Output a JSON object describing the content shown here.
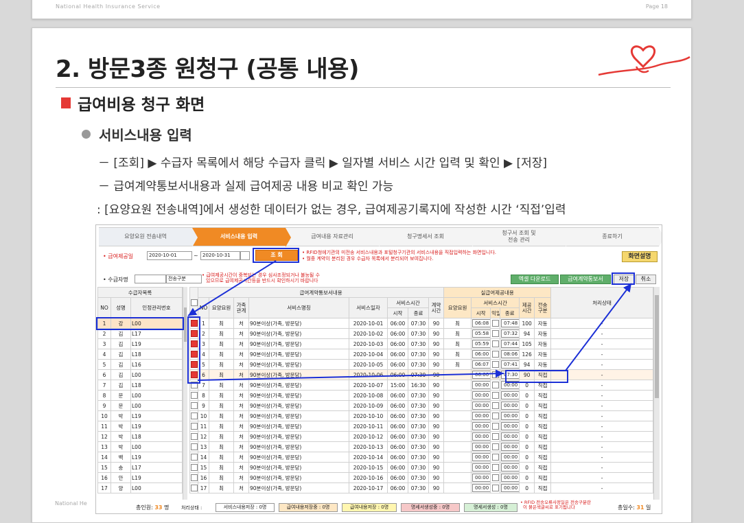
{
  "prev_slide": {
    "footer": "National Health Insurance Service",
    "page": "Page 18"
  },
  "slide": {
    "title": "2. 방문3종 원청구 (공통 내용)",
    "section": "급여비용 청구 화면",
    "subsection": "서비스내용 입력",
    "bullets": [
      "－ [조회] ▶ 수급자 목록에서 해당 수급자 클릭 ▶ 일자별 서비스 시간 입력 및 확인 ▶ [저장]",
      "－ 급여계약통보서내용과 실제 급여제공 내용 비교 확인 가능",
      ": [요양요원 전송내역]에서 생성한 데이터가 없는 경우, 급여제공기록지에 작성한 시간 ‘직접’입력"
    ],
    "footer_partial": "National He"
  },
  "colors": {
    "accent": "#f08a24",
    "highlight_box": "#1b2fd6",
    "bullet_square": "#e53935",
    "logo": "#e53935"
  },
  "app": {
    "steps": [
      "요양요원 전송내역",
      "서비스내용 입력",
      "급여내용 자료관리",
      "청구명세서 조회",
      "청구서 조회 및\n전송 관리",
      "종료하기"
    ],
    "active_step": 1,
    "filter": {
      "period_label": "• 급여제공일",
      "date_from": "2020-10-01",
      "date_to": "2020-10-31",
      "tilde": "~",
      "search_button": "조 회",
      "notice_1": "• RFID청에기관의 미전송 서비스내용과 포털청구기관의 서비스내용을 직접입력하는 화면입니다.",
      "notice_2": "• 월중 계약이 분리된 경우 수급자 목록에서 분리되어 보여집니다.",
      "screen_help": "화면설명",
      "recipient_label": "• 수급자명",
      "send_type": "전송구분",
      "warn_1": "• 급여제공시간이 중복되는 경우 심사조정되거나 불능될 수",
      "warn_2": "있으므로 급여제공시간등을 반드시 확인하시기 바랍니다",
      "excel_button": "엑셀 다운로드",
      "contract_button": "급여계약통보서",
      "save_button": "저장",
      "cancel_button": "취소"
    },
    "left_table": {
      "group": "수급자목록",
      "headers": [
        "NO",
        "성명",
        "인정관리번호"
      ],
      "rows": [
        [
          "1",
          "강",
          "L00"
        ],
        [
          "2",
          "김",
          "L17"
        ],
        [
          "3",
          "김",
          "L19"
        ],
        [
          "4",
          "김",
          "L18"
        ],
        [
          "5",
          "김",
          "L16"
        ],
        [
          "6",
          "김",
          "L00"
        ],
        [
          "7",
          "김",
          "L18"
        ],
        [
          "8",
          "문",
          "L00"
        ],
        [
          "9",
          "문",
          "L00"
        ],
        [
          "10",
          "박",
          "L19"
        ],
        [
          "11",
          "박",
          "L19"
        ],
        [
          "12",
          "박",
          "L18"
        ],
        [
          "13",
          "박",
          "L00"
        ],
        [
          "14",
          "백",
          "L19"
        ],
        [
          "15",
          "송",
          "L17"
        ],
        [
          "16",
          "안",
          "L19"
        ],
        [
          "17",
          "양",
          "L00"
        ]
      ]
    },
    "right_table": {
      "contract_group": "급여계약통보서내용",
      "actual_group": "실급여제공내용",
      "headers": [
        "NO",
        "요양요원",
        "가족\n관계",
        "서비스명칭",
        "서비스일자",
        "서비스시간",
        "계약\n시간",
        "요양요원",
        "서비스시간",
        "제공\n시간",
        "전송\n구분",
        "처리상태"
      ],
      "sub_start": "시작",
      "sub_end": "종료",
      "sub_next": "익일",
      "rows": [
        {
          "no": "1",
          "worker": "최",
          "rel": "처",
          "svc": "90분이상(가족, 방문당)",
          "date": "2020-10-01",
          "start": "06:00",
          "end": "07:30",
          "ct": "90",
          "aw": "최",
          "as": "06:08",
          "ae": "07:48",
          "pt": "100",
          "tx": "자동",
          "st": "-"
        },
        {
          "no": "2",
          "worker": "최",
          "rel": "처",
          "svc": "90분이상(가족, 방문당)",
          "date": "2020-10-02",
          "start": "06:00",
          "end": "07:30",
          "ct": "90",
          "aw": "최",
          "as": "05:58",
          "ae": "07:32",
          "pt": "94",
          "tx": "자동",
          "st": "-"
        },
        {
          "no": "3",
          "worker": "최",
          "rel": "처",
          "svc": "90분이상(가족, 방문당)",
          "date": "2020-10-03",
          "start": "06:00",
          "end": "07:30",
          "ct": "90",
          "aw": "최",
          "as": "05:59",
          "ae": "07:44",
          "pt": "105",
          "tx": "자동",
          "st": "-"
        },
        {
          "no": "4",
          "worker": "최",
          "rel": "처",
          "svc": "90분이상(가족, 방문당)",
          "date": "2020-10-04",
          "start": "06:00",
          "end": "07:30",
          "ct": "90",
          "aw": "최",
          "as": "06:00",
          "ae": "08:06",
          "pt": "126",
          "tx": "자동",
          "st": "-"
        },
        {
          "no": "5",
          "worker": "최",
          "rel": "처",
          "svc": "90분이상(가족, 방문당)",
          "date": "2020-10-05",
          "start": "06:00",
          "end": "07:30",
          "ct": "90",
          "aw": "최",
          "as": "06:07",
          "ae": "07:41",
          "pt": "94",
          "tx": "자동",
          "st": "-"
        },
        {
          "no": "6",
          "worker": "최",
          "rel": "처",
          "svc": "90분이상(가족, 방문당)",
          "date": "2020-10-06",
          "start": "06:00",
          "end": "07:30",
          "ct": "90",
          "aw": "",
          "as": "06:00",
          "ae": "07:30",
          "pt": "90",
          "tx": "직접",
          "st": "-"
        },
        {
          "no": "7",
          "worker": "최",
          "rel": "처",
          "svc": "90분이상(가족, 방문당)",
          "date": "2020-10-07",
          "start": "15:00",
          "end": "16:30",
          "ct": "90",
          "aw": "",
          "as": "00:00",
          "ae": "00:00",
          "pt": "0",
          "tx": "직접",
          "st": "-"
        },
        {
          "no": "8",
          "worker": "최",
          "rel": "처",
          "svc": "90분이상(가족, 방문당)",
          "date": "2020-10-08",
          "start": "06:00",
          "end": "07:30",
          "ct": "90",
          "aw": "",
          "as": "00:00",
          "ae": "00:00",
          "pt": "0",
          "tx": "직접",
          "st": "-"
        },
        {
          "no": "9",
          "worker": "최",
          "rel": "처",
          "svc": "90분이상(가족, 방문당)",
          "date": "2020-10-09",
          "start": "06:00",
          "end": "07:30",
          "ct": "90",
          "aw": "",
          "as": "00:00",
          "ae": "00:00",
          "pt": "0",
          "tx": "직접",
          "st": "-"
        },
        {
          "no": "10",
          "worker": "최",
          "rel": "처",
          "svc": "90분이상(가족, 방문당)",
          "date": "2020-10-10",
          "start": "06:00",
          "end": "07:30",
          "ct": "90",
          "aw": "",
          "as": "00:00",
          "ae": "00:00",
          "pt": "0",
          "tx": "직접",
          "st": "-"
        },
        {
          "no": "11",
          "worker": "최",
          "rel": "처",
          "svc": "90분이상(가족, 방문당)",
          "date": "2020-10-11",
          "start": "06:00",
          "end": "07:30",
          "ct": "90",
          "aw": "",
          "as": "00:00",
          "ae": "00:00",
          "pt": "0",
          "tx": "직접",
          "st": "-"
        },
        {
          "no": "12",
          "worker": "최",
          "rel": "처",
          "svc": "90분이상(가족, 방문당)",
          "date": "2020-10-12",
          "start": "06:00",
          "end": "07:30",
          "ct": "90",
          "aw": "",
          "as": "00:00",
          "ae": "00:00",
          "pt": "0",
          "tx": "직접",
          "st": "-"
        },
        {
          "no": "13",
          "worker": "최",
          "rel": "처",
          "svc": "90분이상(가족, 방문당)",
          "date": "2020-10-13",
          "start": "06:00",
          "end": "07:30",
          "ct": "90",
          "aw": "",
          "as": "00:00",
          "ae": "00:00",
          "pt": "0",
          "tx": "직접",
          "st": "-"
        },
        {
          "no": "14",
          "worker": "최",
          "rel": "처",
          "svc": "90분이상(가족, 방문당)",
          "date": "2020-10-14",
          "start": "06:00",
          "end": "07:30",
          "ct": "90",
          "aw": "",
          "as": "00:00",
          "ae": "00:00",
          "pt": "0",
          "tx": "직접",
          "st": "-"
        },
        {
          "no": "15",
          "worker": "최",
          "rel": "처",
          "svc": "90분이상(가족, 방문당)",
          "date": "2020-10-15",
          "start": "06:00",
          "end": "07:30",
          "ct": "90",
          "aw": "",
          "as": "00:00",
          "ae": "00:00",
          "pt": "0",
          "tx": "직접",
          "st": "-"
        },
        {
          "no": "16",
          "worker": "최",
          "rel": "처",
          "svc": "90분이상(가족, 방문당)",
          "date": "2020-10-16",
          "start": "06:00",
          "end": "07:30",
          "ct": "90",
          "aw": "",
          "as": "00:00",
          "ae": "00:00",
          "pt": "0",
          "tx": "직접",
          "st": "-"
        },
        {
          "no": "17",
          "worker": "최",
          "rel": "처",
          "svc": "90분이상(가족, 방문당)",
          "date": "2020-10-17",
          "start": "06:00",
          "end": "07:30",
          "ct": "90",
          "aw": "",
          "as": "00:00",
          "ae": "00:00",
          "pt": "0",
          "tx": "직접",
          "st": "-"
        }
      ]
    },
    "footer": {
      "total_label": "총인원:",
      "total_value": "33",
      "total_unit": "명",
      "status_label": "처리상태 :",
      "chips": [
        "서비스내용저장 : 0명",
        "급여내용저장중 : 0명",
        "급여내용저장 : 0명",
        "명세서생성중 : 0명",
        "명세서생성 : 0명"
      ],
      "rfid_note_1": "• RFID 전송오류사정일은 전송구분란",
      "rfid_note_2": "이 붉은색글씨로 표기됩니다",
      "days_label": "총일수:",
      "days_value": "31",
      "days_unit": "일"
    }
  }
}
